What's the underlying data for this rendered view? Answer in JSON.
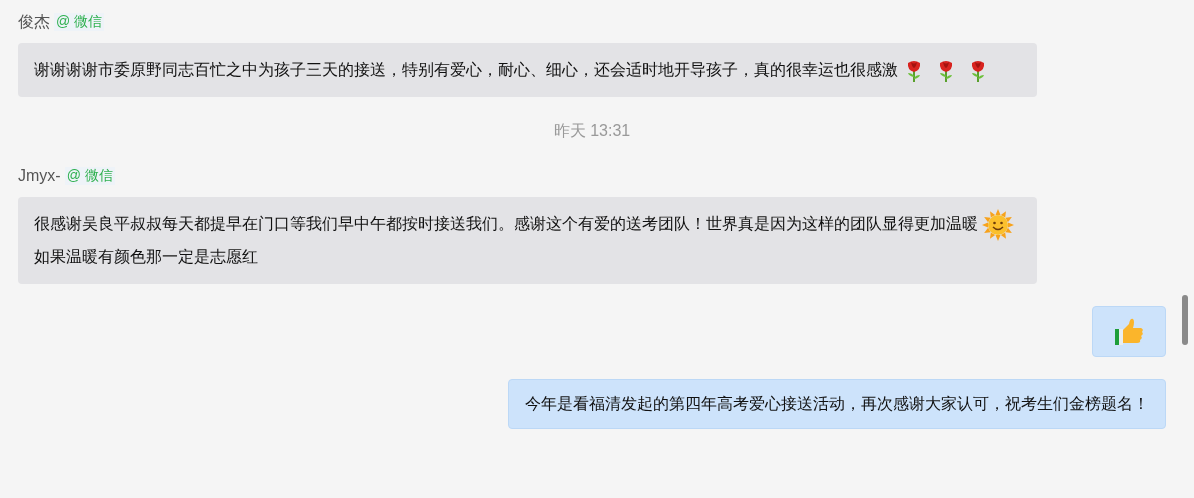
{
  "messages": [
    {
      "kind": "incoming",
      "sender": "俊杰",
      "source": "@ 微信",
      "parts": [
        {
          "kind": "text",
          "text": "谢谢谢谢市委原野同志百忙之中为孩子三天的接送，特别有爱心，耐心、细心，还会适时地开导孩子，真的很幸运也很感激"
        },
        {
          "kind": "rose"
        },
        {
          "kind": "rose"
        },
        {
          "kind": "rose"
        }
      ]
    },
    {
      "kind": "time",
      "text": "昨天 13:31"
    },
    {
      "kind": "incoming",
      "sender": "Jmyx-",
      "source": "@ 微信",
      "parts": [
        {
          "kind": "text",
          "text": "很感谢吴良平叔叔每天都提早在门口等我们早中午都按时接送我们。感谢这个有爱的送考团队！世界真是因为这样的团队显得更加温暖"
        },
        {
          "kind": "sun"
        },
        {
          "kind": "text",
          "text": "如果温暖有颜色那一定是志愿红"
        }
      ]
    },
    {
      "kind": "outgoing",
      "parts": [
        {
          "kind": "thumbs_up"
        }
      ]
    },
    {
      "kind": "outgoing",
      "parts": [
        {
          "kind": "text",
          "text": "今年是看福清发起的第四年高考爱心接送活动，再次感谢大家认可，祝考生们金榜题名！"
        }
      ]
    }
  ]
}
